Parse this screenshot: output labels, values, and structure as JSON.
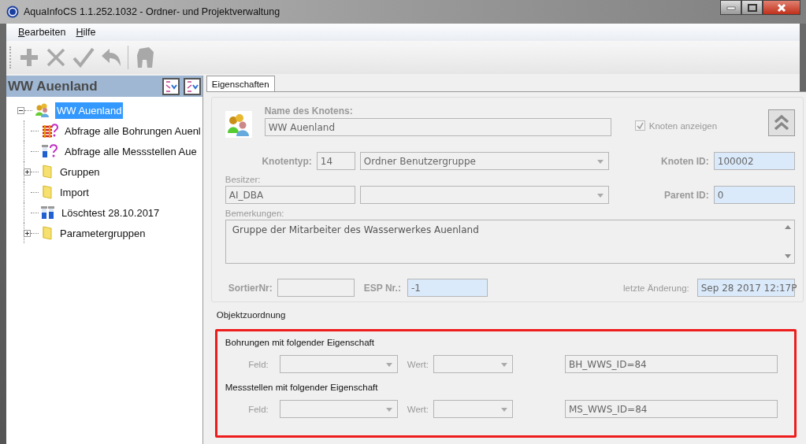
{
  "window": {
    "title": "AquaInfoCS 1.1.252.1032 - Ordner- und Projektverwaltung"
  },
  "menu": [
    {
      "label": "Bearbeiten"
    },
    {
      "label": "Hilfe"
    }
  ],
  "toolbar": [
    {
      "kind": "add",
      "disabled": true
    },
    {
      "kind": "delete",
      "disabled": true
    },
    {
      "kind": "confirm",
      "disabled": true
    },
    {
      "kind": "undo",
      "disabled": true
    },
    {
      "kind": "separator"
    },
    {
      "kind": "tool",
      "disabled": true
    }
  ],
  "tree": {
    "header": "WW Auenland",
    "root": {
      "label": "WW Auenland",
      "kind": "group",
      "expanded": true,
      "selected": true,
      "children": [
        {
          "label": "Abfrage alle Bohrungen Auenl",
          "kind": "query-bohrung",
          "selected": false
        },
        {
          "label": "Abfrage alle Messstellen Aue",
          "kind": "query-messstelle",
          "selected": false
        },
        {
          "label": "Gruppen",
          "kind": "folder",
          "expanded": false,
          "selected": false
        },
        {
          "label": "Import",
          "kind": "folder",
          "selected": false
        },
        {
          "label": "Löschtest 28.10.2017",
          "kind": "samples",
          "selected": false
        },
        {
          "label": "Parametergruppen",
          "kind": "folder",
          "expanded": false,
          "selected": false
        }
      ]
    }
  },
  "tabs": [
    {
      "label": "Eigenschaften",
      "selected": true
    }
  ],
  "properties": {
    "name": {
      "label": "Name des Knotens:",
      "value": "WW Auenland",
      "highlighted": false
    },
    "show_node": {
      "label": "Knoten anzeigen",
      "checked": true
    },
    "node_type": {
      "label": "Knotentyp:",
      "code": "14",
      "value": "Ordner Benutzergruppe"
    },
    "node_id": {
      "label": "Knoten ID:",
      "value": "100002",
      "highlighted": true
    },
    "owner": {
      "label": "Besitzer:",
      "value": "AI_DBA",
      "highlighted": false
    },
    "parent_id": {
      "label": "Parent ID:",
      "value": "0",
      "highlighted": true
    },
    "remarks": {
      "label": "Bemerkungen:",
      "value": "Gruppe der Mitarbeiter des Wasserwerkes Auenland"
    },
    "sort_nr": {
      "label": "SortierNr:",
      "highlighted": false
    },
    "esp_nr": {
      "label": "ESP Nr.:",
      "value": "-1",
      "highlighted": true
    },
    "last_change": {
      "label": "letzte Änderung:",
      "value": "Sep 28 2017 12:17P",
      "highlighted": true
    }
  },
  "assignment": {
    "title": "Objektzuordnung",
    "highlighted": true,
    "rows": [
      {
        "heading": "Bohrungen mit folgender Eigenschaft",
        "field_label": "Feld:",
        "value_label": "Wert:",
        "expression": "BH_WWS_ID=84"
      },
      {
        "heading": "Messstellen mit folgender Eigenschaft",
        "field_label": "Feld:",
        "value_label": "Wert:",
        "expression": "MS_WWS_ID=84"
      }
    ]
  }
}
